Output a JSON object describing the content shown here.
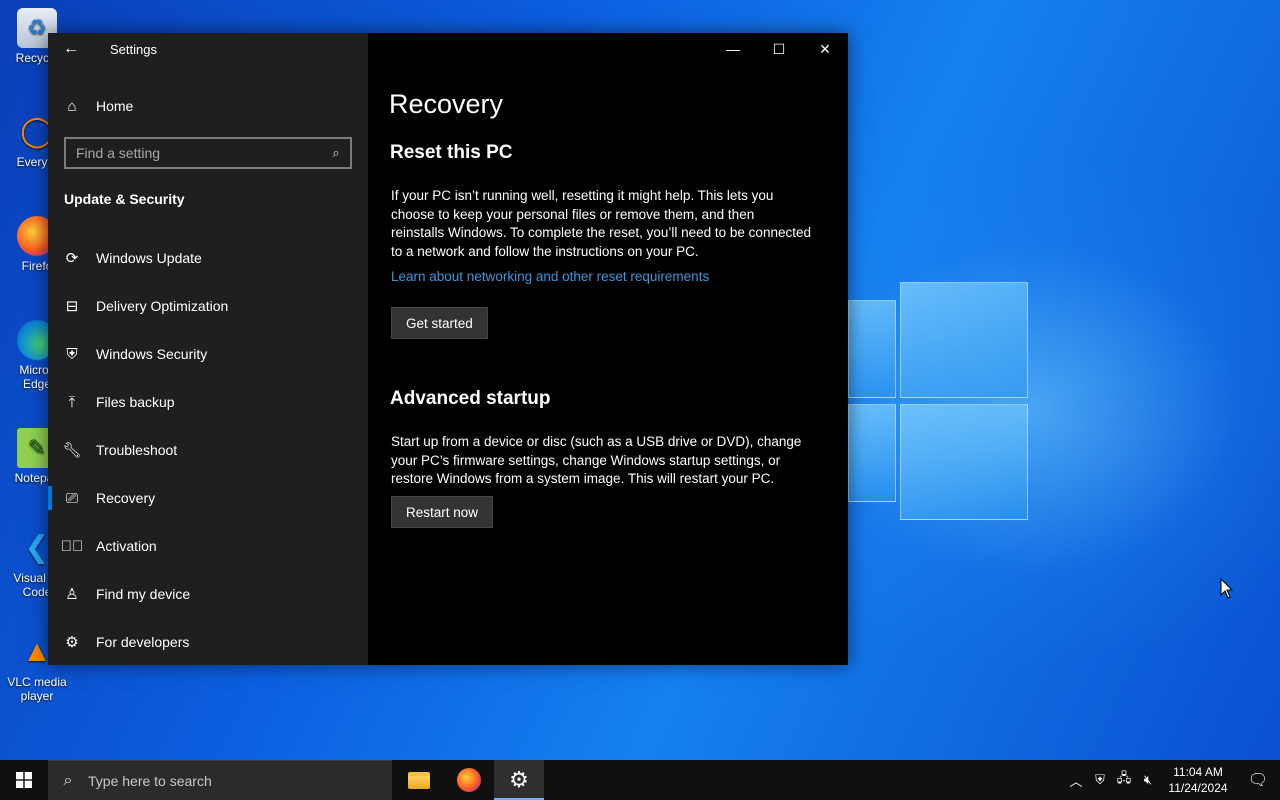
{
  "desktop": {
    "icons": [
      {
        "label": "Recycle",
        "icon": "recycle-bin-icon"
      },
      {
        "label": "Everyth",
        "icon": "everything-search-icon"
      },
      {
        "label": "Firefo",
        "icon": "firefox-icon"
      },
      {
        "label": "Micros Edge",
        "icon": "edge-icon"
      },
      {
        "label": "Notepac",
        "icon": "notepad-icon"
      },
      {
        "label": "Visual St Code",
        "icon": "vscode-icon"
      },
      {
        "label": "VLC media player",
        "icon": "vlc-icon"
      }
    ]
  },
  "window": {
    "app_title": "Settings",
    "sidebar": {
      "home_label": "Home",
      "search_placeholder": "Find a setting",
      "section_title": "Update & Security",
      "items": [
        {
          "label": "Windows Update",
          "icon": "sync-icon"
        },
        {
          "label": "Delivery Optimization",
          "icon": "delivery-optimization-icon"
        },
        {
          "label": "Windows Security",
          "icon": "shield-icon"
        },
        {
          "label": "Files backup",
          "icon": "backup-upload-icon"
        },
        {
          "label": "Troubleshoot",
          "icon": "wrench-icon"
        },
        {
          "label": "Recovery",
          "icon": "recovery-icon"
        },
        {
          "label": "Activation",
          "icon": "check-circle-icon"
        },
        {
          "label": "Find my device",
          "icon": "find-device-icon"
        },
        {
          "label": "For developers",
          "icon": "developer-icon"
        }
      ]
    },
    "content": {
      "page_title": "Recovery",
      "reset": {
        "heading": "Reset this PC",
        "text": "If your PC isn’t running well, resetting it might help. This lets you choose to keep your personal files or remove them, and then reinstalls Windows. To complete the reset, you’ll need to be connected to a network and follow the instructions on your PC.",
        "link": "Learn about networking and other reset requirements",
        "button": "Get started"
      },
      "advanced": {
        "heading": "Advanced startup",
        "text": "Start up from a device or disc (such as a USB drive or DVD), change your PC’s firmware settings, change Windows startup settings, or restore Windows from a system image. This will restart your PC.",
        "button": "Restart now"
      }
    }
  },
  "taskbar": {
    "search_placeholder": "Type here to search",
    "apps": [
      "file-explorer-icon",
      "firefox-icon",
      "settings-gear-icon"
    ],
    "clock_time": "11:04 AM",
    "clock_date": "11/24/2024"
  },
  "colors": {
    "accent": "#0078d7",
    "link": "#3a96dd",
    "sidebar_bg": "#1f1f1f",
    "content_bg": "#000000"
  }
}
